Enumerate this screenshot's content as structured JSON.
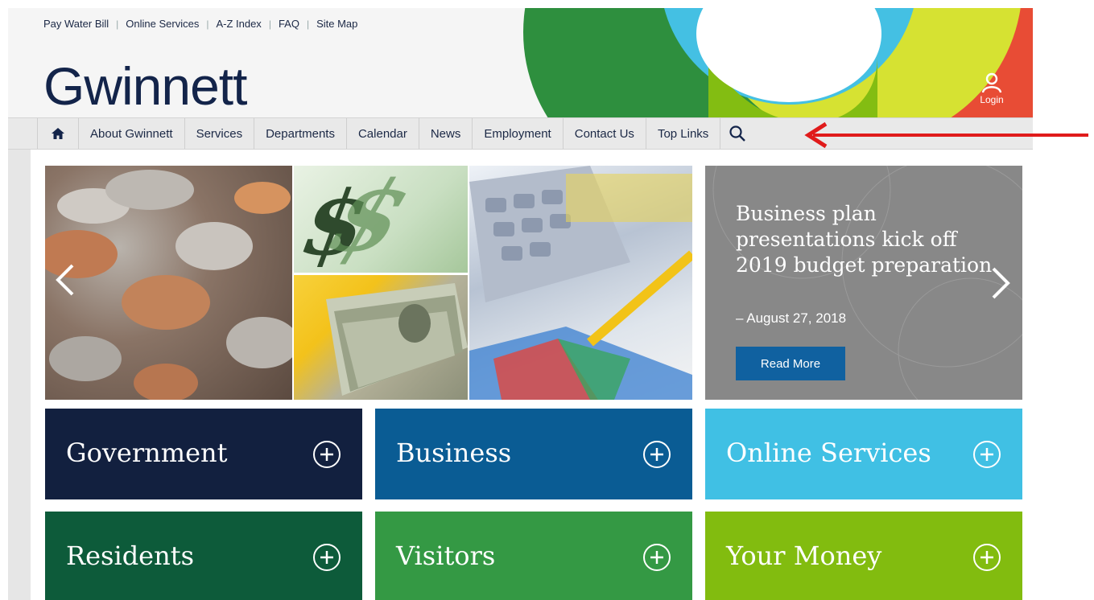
{
  "utility_links": [
    "Pay Water Bill",
    "Online Services",
    "A-Z Index",
    "FAQ",
    "Site Map"
  ],
  "logo_text": "Gwinnett",
  "login_label": "Login",
  "nav": {
    "home_icon": "home-icon",
    "items": [
      "About Gwinnett",
      "Services",
      "Departments",
      "Calendar",
      "News",
      "Employment",
      "Contact Us",
      "Top Links"
    ],
    "search_icon": "search-icon"
  },
  "feature": {
    "title": "Business plan presentations kick off 2019 budget preparation",
    "date": "– August 27, 2018",
    "button": "Read More"
  },
  "categories": {
    "government": "Government",
    "business": "Business",
    "online_services": "Online Services",
    "residents": "Residents",
    "visitors": "Visitors",
    "your_money": "Your Money"
  },
  "colors": {
    "brand_navy": "#13244a",
    "login_red": "#e84c35",
    "read_more_blue": "#1061a0",
    "government": "#12203f",
    "business": "#0a5c94",
    "online_services": "#40c0e4",
    "residents": "#0d5b3a",
    "visitors": "#349944",
    "your_money": "#82bc0f",
    "annotation_arrow": "#e01b1b"
  }
}
